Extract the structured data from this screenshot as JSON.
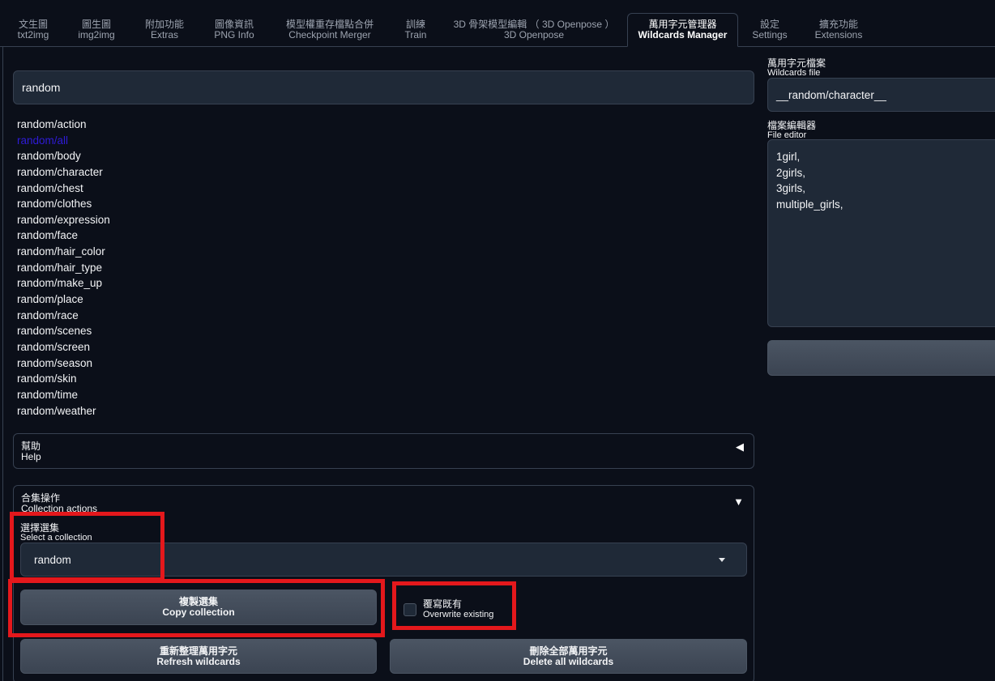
{
  "tabs": [
    {
      "zh": "文生圖",
      "en": "txt2img"
    },
    {
      "zh": "圖生圖",
      "en": "img2img"
    },
    {
      "zh": "附加功能",
      "en": "Extras"
    },
    {
      "zh": "圖像資訊",
      "en": "PNG Info"
    },
    {
      "zh": "模型權重存檔點合併",
      "en": "Checkpoint Merger"
    },
    {
      "zh": "訓練",
      "en": "Train"
    },
    {
      "zh": "3D 骨架模型編輯 （ 3D Openpose ）",
      "en": "3D Openpose"
    },
    {
      "zh": "萬用字元管理器",
      "en": "Wildcards Manager"
    },
    {
      "zh": "設定",
      "en": "Settings"
    },
    {
      "zh": "擴充功能",
      "en": "Extensions"
    }
  ],
  "search": {
    "value": "random"
  },
  "wildcards": [
    "random/action",
    "random/all",
    "random/body",
    "random/character",
    "random/chest",
    "random/clothes",
    "random/expression",
    "random/face",
    "random/hair_color",
    "random/hair_type",
    "random/make_up",
    "random/place",
    "random/race",
    "random/scenes",
    "random/screen",
    "random/season",
    "random/skin",
    "random/time",
    "random/weather"
  ],
  "help": {
    "zh": "幫助",
    "en": "Help",
    "arrow": "◀"
  },
  "collection": {
    "zh": "合集操作",
    "en": "Collection actions",
    "arrow": "▼",
    "select_label_zh": "選擇選集",
    "select_label_en": "Select a collection",
    "selected": "random",
    "copy_zh": "複製選集",
    "copy_en": "Copy collection",
    "overwrite_zh": "覆寫既有",
    "overwrite_en": "Overwrite existing",
    "refresh_zh": "重新整理萬用字元",
    "refresh_en": "Refresh wildcards",
    "delete_zh": "刪除全部萬用字元",
    "delete_en": "Delete all wildcards"
  },
  "right": {
    "file_label_zh": "萬用字元檔案",
    "file_label_en": "Wildcards file",
    "file_value": "__random/character__",
    "editor_label_zh": "檔案編輯器",
    "editor_label_en": "File editor",
    "editor_content": "1girl,\n2girls,\n3girls,\nmultiple_girls,"
  },
  "colors": {
    "background": "#0b0f19",
    "panel": "#1f2937",
    "button": "#4b5563",
    "highlight": "#e4181c",
    "link": "#2f1bd8"
  }
}
